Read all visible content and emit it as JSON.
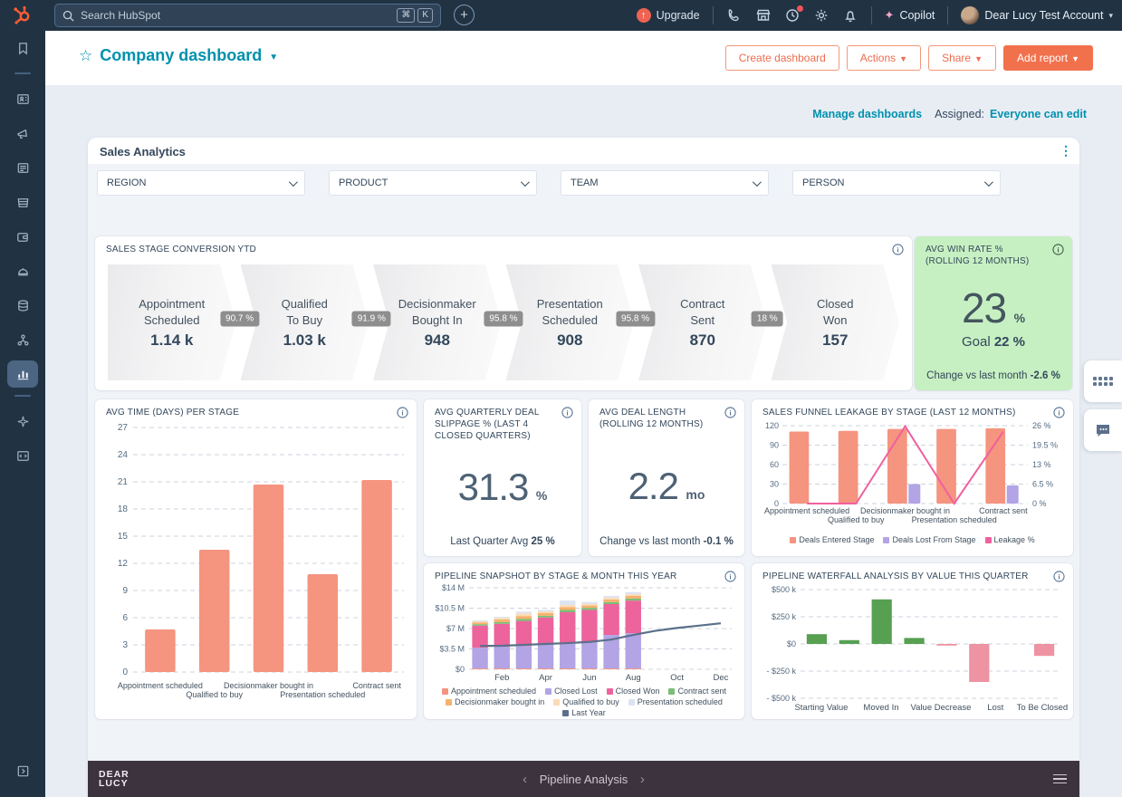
{
  "topbar": {
    "search_placeholder": "Search HubSpot",
    "shortcut_cmd": "⌘",
    "shortcut_key": "K",
    "upgrade": "Upgrade",
    "copilot": "Copilot",
    "account": "Dear Lucy Test Account"
  },
  "header": {
    "title": "Company dashboard",
    "create": "Create dashboard",
    "actions": "Actions",
    "share": "Share",
    "add_report": "Add report"
  },
  "subheader": {
    "manage": "Manage dashboards",
    "assigned_label": "Assigned:",
    "assigned_value": "Everyone can edit"
  },
  "section": {
    "title": "Sales Analytics"
  },
  "filters": [
    {
      "label": "REGION"
    },
    {
      "label": "PRODUCT"
    },
    {
      "label": "TEAM"
    },
    {
      "label": "PERSON"
    }
  ],
  "funnel": {
    "title": "SALES STAGE CONVERSION YTD",
    "stages": [
      {
        "line1": "Appointment",
        "line2": "Scheduled",
        "value": "1.14 k"
      },
      {
        "line1": "Qualified",
        "line2": "To Buy",
        "value": "1.03 k"
      },
      {
        "line1": "Decisionmaker",
        "line2": "Bought In",
        "value": "948"
      },
      {
        "line1": "Presentation",
        "line2": "Scheduled",
        "value": "908"
      },
      {
        "line1": "Contract",
        "line2": "Sent",
        "value": "870"
      },
      {
        "line1": "Closed",
        "line2": "Won",
        "value": "157"
      }
    ],
    "conversions": [
      "90.7 %",
      "91.9 %",
      "95.8 %",
      "95.8 %",
      "18 %"
    ]
  },
  "win_rate": {
    "title": "AVG WIN RATE % (ROLLING 12 MONTHS)",
    "value": "23",
    "unit": "%",
    "goal_label": "Goal",
    "goal_value": "22 %",
    "change_label": "Change vs last month",
    "change_value": "-2.6 %"
  },
  "slippage": {
    "title": "AVG QUARTERLY DEAL SLIPPAGE % (LAST 4 CLOSED QUARTERS)",
    "value": "31.3",
    "unit": "%",
    "footer_label": "Last Quarter Avg",
    "footer_value": "25 %"
  },
  "deal_length": {
    "title": "AVG DEAL LENGTH (ROLLING 12 MONTHS)",
    "value": "2.2",
    "unit": "mo",
    "footer_label": "Change vs last month",
    "footer_value": "-0.1 %"
  },
  "footer": {
    "logo1": "DEAR",
    "logo2": "LUCY",
    "nav": "Pipeline Analysis"
  },
  "colors": {
    "accent_teal": "#0091ae",
    "cta_orange": "#f2714d",
    "navy": "#213343",
    "salmon": "#f5947f",
    "purple": "#b2a4e5",
    "pink": "#ed639c",
    "green": "#57a052",
    "green_card_bg": "#c7f0c2",
    "slate_line": "#5b708b"
  },
  "chart_data": [
    {
      "id": "avg_time",
      "type": "bar",
      "title": "AVG TIME (DAYS) PER STAGE",
      "categories": [
        "Appointment scheduled",
        "Qualified to buy",
        "Decisionmaker bought in",
        "Presentation scheduled",
        "Contract sent"
      ],
      "values": [
        4.7,
        13.5,
        20.7,
        10.8,
        21.2
      ],
      "ylim": [
        0,
        27
      ],
      "ytick_step": 3,
      "bar_color": "#f5947f",
      "grid": true,
      "xlabel": "",
      "ylabel": ""
    },
    {
      "id": "leakage",
      "type": "bar",
      "title": "SALES FUNNEL LEAKAGE BY STAGE (LAST 12 MONTHS)",
      "categories": [
        "Appointment scheduled",
        "Qualified to buy",
        "Decisionmaker bought in",
        "Presentation scheduled",
        "Contract sent"
      ],
      "series": [
        {
          "name": "Deals Entered Stage",
          "kind": "bar",
          "color": "#f5947f",
          "values": [
            111,
            112,
            115,
            115,
            116
          ]
        },
        {
          "name": "Deals Lost From Stage",
          "kind": "bar",
          "color": "#b2a4e5",
          "values": [
            0,
            0,
            30,
            0,
            28
          ]
        },
        {
          "name": "Leakage %",
          "kind": "line",
          "color": "#f0609e",
          "axis": "right",
          "values": [
            0,
            0,
            25.8,
            0,
            24
          ]
        }
      ],
      "ylim_left": [
        0,
        120
      ],
      "yticks_left": [
        0,
        30,
        60,
        90,
        120
      ],
      "ylim_right": [
        0,
        26
      ],
      "yticks_right": [
        "0 %",
        "6.5 %",
        "13 %",
        "19.5 %",
        "26 %"
      ],
      "legend_position": "bottom",
      "grid": true
    },
    {
      "id": "snapshot",
      "type": "area",
      "title": "PIPELINE SNAPSHOT BY STAGE & MONTH THIS YEAR",
      "x_slots": 12,
      "xtick_labels": [
        "Feb",
        "Apr",
        "Jun",
        "Aug",
        "Oct",
        "Dec"
      ],
      "xtick_idx": [
        1,
        3,
        5,
        7,
        9,
        11
      ],
      "ylim": [
        0,
        14
      ],
      "unit": "$M",
      "yticks": [
        {
          "v": 0,
          "label": "$0"
        },
        {
          "v": 3.5,
          "label": "$3.5 M"
        },
        {
          "v": 7,
          "label": "$7 M"
        },
        {
          "v": 10.5,
          "label": "$10.5 M"
        },
        {
          "v": 14,
          "label": "$14 M"
        }
      ],
      "series": [
        {
          "name": "Appointment scheduled",
          "kind": "bar",
          "color": "#f5947f",
          "values": [
            0.15,
            0.15,
            0.15,
            0.15,
            0.15,
            0.15,
            0.15,
            0.15
          ]
        },
        {
          "name": "Closed Lost",
          "kind": "bar",
          "color": "#b2a4e5",
          "values": [
            3.55,
            3.75,
            3.85,
            4.15,
            4.45,
            4.65,
            5.75,
            6.05
          ]
        },
        {
          "name": "Closed Won",
          "kind": "bar",
          "color": "#ed639c",
          "values": [
            3.8,
            3.9,
            4.3,
            4.6,
            5.2,
            5.4,
            5.3,
            5.6
          ]
        },
        {
          "name": "Contract sent",
          "kind": "bar",
          "color": "#7cbd77",
          "values": [
            0.25,
            0.3,
            0.35,
            0.3,
            0.4,
            0.35,
            0.35,
            0.35
          ]
        },
        {
          "name": "Decisionmaker bought in",
          "kind": "bar",
          "color": "#f5b26e",
          "values": [
            0.3,
            0.45,
            0.5,
            0.45,
            0.5,
            0.4,
            0.45,
            0.45
          ]
        },
        {
          "name": "Qualified to buy",
          "kind": "bar",
          "color": "#fadcb8",
          "values": [
            0.2,
            0.25,
            0.45,
            0.3,
            0.35,
            0.3,
            0.3,
            0.3
          ]
        },
        {
          "name": "Presentation scheduled",
          "kind": "bar",
          "color": "#dce3f2",
          "values": [
            0.15,
            0.2,
            0.3,
            0.25,
            0.75,
            0.3,
            0.3,
            0.35
          ]
        },
        {
          "name": "Last Year",
          "kind": "line",
          "color": "#5b708b",
          "values": [
            4.0,
            4.05,
            4.2,
            4.35,
            4.5,
            4.7,
            5.1,
            5.9,
            6.6,
            7.1,
            7.5,
            7.9
          ]
        }
      ],
      "legend_position": "bottom",
      "grid": true
    },
    {
      "id": "waterfall",
      "type": "bar",
      "title": "PIPELINE WATERFALL ANALYSIS BY VALUE THIS QUARTER",
      "values_k": [
        90,
        35,
        410,
        55,
        -15,
        -350,
        0,
        -110
      ],
      "xtick_labels": [
        "Starting Value",
        "Moved In",
        "Value Decrease",
        "Lost",
        "To Be Closed"
      ],
      "label_fractions": [
        0.08,
        0.31,
        0.54,
        0.75,
        0.93
      ],
      "ylim": [
        -500,
        500
      ],
      "yticks": [
        {
          "v": 500,
          "label": "$500 k"
        },
        {
          "v": 250,
          "label": "$250 k"
        },
        {
          "v": 0,
          "label": "$0"
        },
        {
          "v": -250,
          "label": "- $250 k"
        },
        {
          "v": -500,
          "label": "- $500 k"
        }
      ],
      "pos_color": "#57a052",
      "neg_color": "#ed93a2",
      "grid": true
    }
  ]
}
